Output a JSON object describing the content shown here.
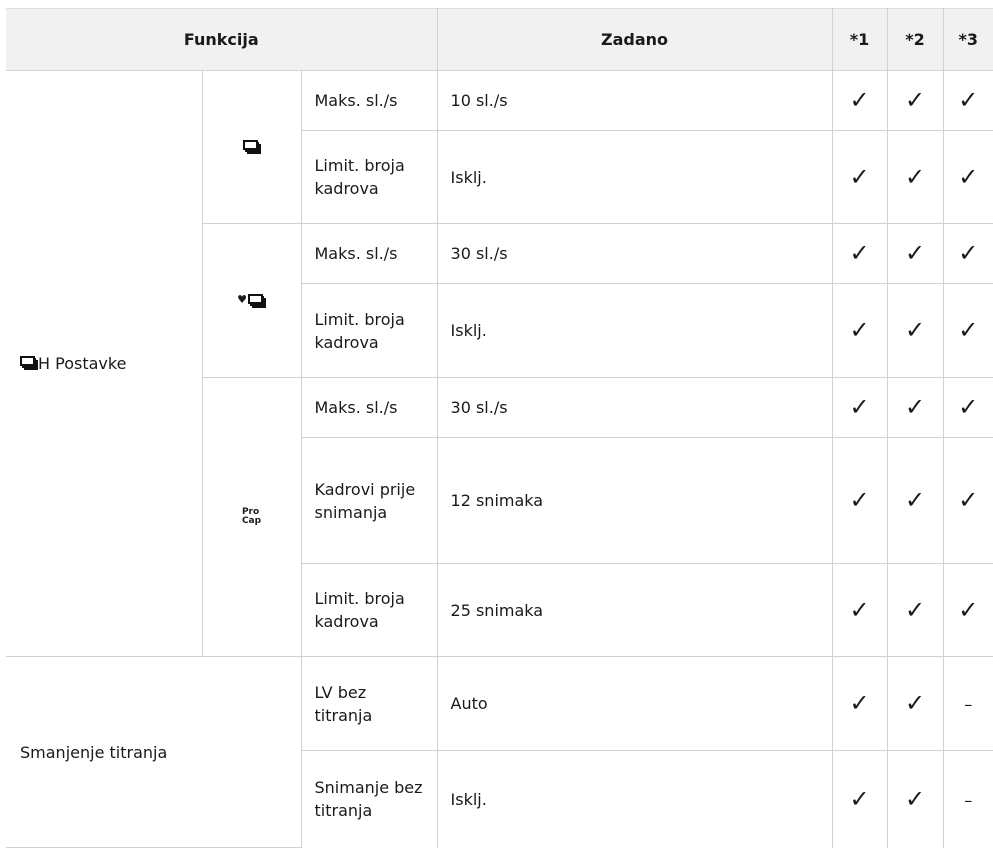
{
  "header": {
    "funkcija": "Funkcija",
    "zadano": "Zadano",
    "c1": "*1",
    "c2": "*2",
    "c3": "*3"
  },
  "rows": [
    {
      "sub": "Maks. sl./s",
      "value": "10 sl./s",
      "m1": "✓",
      "m2": "✓",
      "m3": "✓"
    },
    {
      "sub": "Limit. broja kadrova",
      "value": "Isklj.",
      "m1": "✓",
      "m2": "✓",
      "m3": "✓"
    },
    {
      "sub": "Maks. sl./s",
      "value": "30 sl./s",
      "m1": "✓",
      "m2": "✓",
      "m3": "✓"
    },
    {
      "sub": "Limit. broja kadrova",
      "value": "Isklj.",
      "m1": "✓",
      "m2": "✓",
      "m3": "✓"
    },
    {
      "sub": "Maks. sl./s",
      "value": "30 sl./s",
      "m1": "✓",
      "m2": "✓",
      "m3": "✓"
    },
    {
      "sub": "Kadrovi prije snimanja",
      "value": "12 snimaka",
      "m1": "✓",
      "m2": "✓",
      "m3": "✓"
    },
    {
      "sub": "Limit. broja kadrova",
      "value": "25 snimaka",
      "m1": "✓",
      "m2": "✓",
      "m3": "✓"
    },
    {
      "sub": "LV bez titranja",
      "value": "Auto",
      "m1": "✓",
      "m2": "✓",
      "m3": "–"
    },
    {
      "sub": "Snimanje bez titranja",
      "value": "Isklj.",
      "m1": "✓",
      "m2": "✓",
      "m3": "–"
    }
  ],
  "groups": {
    "burst_settings_suffix": "H Postavke",
    "flicker": "Smanjenje titranja"
  },
  "icons": {
    "burst": "sequential-shooting-icon",
    "heart_burst": "heart-sequential-shooting-icon",
    "procap_top": "Pro",
    "procap_bottom": "Cap"
  }
}
